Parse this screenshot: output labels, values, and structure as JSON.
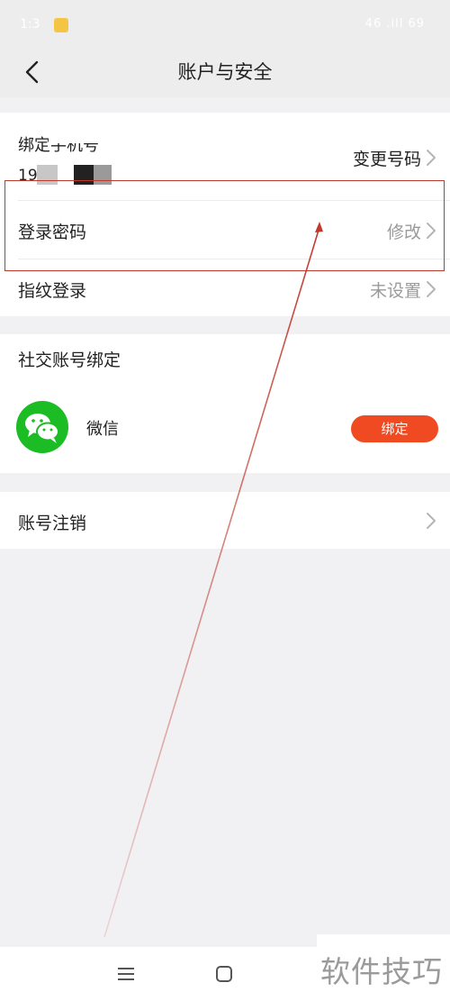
{
  "status_bar": {
    "time": "1:3",
    "right": "46 .ill 69"
  },
  "header": {
    "title": "账户与安全"
  },
  "account": {
    "phone_label": "绑定手机号",
    "phone_prefix": "19",
    "change_phone": "变更号码",
    "password_label": "登录密码",
    "password_action": "修改",
    "fingerprint_label": "指纹登录",
    "fingerprint_action": "未设置"
  },
  "social": {
    "title": "社交账号绑定",
    "items": [
      {
        "name": "微信",
        "action": "绑定"
      }
    ]
  },
  "deactivate": {
    "label": "账号注销"
  },
  "watermark": {
    "text": "软件技巧"
  },
  "colors": {
    "accent": "#f04a23",
    "wechat_green": "#1bbc24",
    "annotation": "#c0392b",
    "background": "#f1f1f4"
  },
  "icons": [
    "back-arrow-icon",
    "chevron-right-icon",
    "wechat-icon",
    "menu-icon",
    "home-square-icon"
  ]
}
